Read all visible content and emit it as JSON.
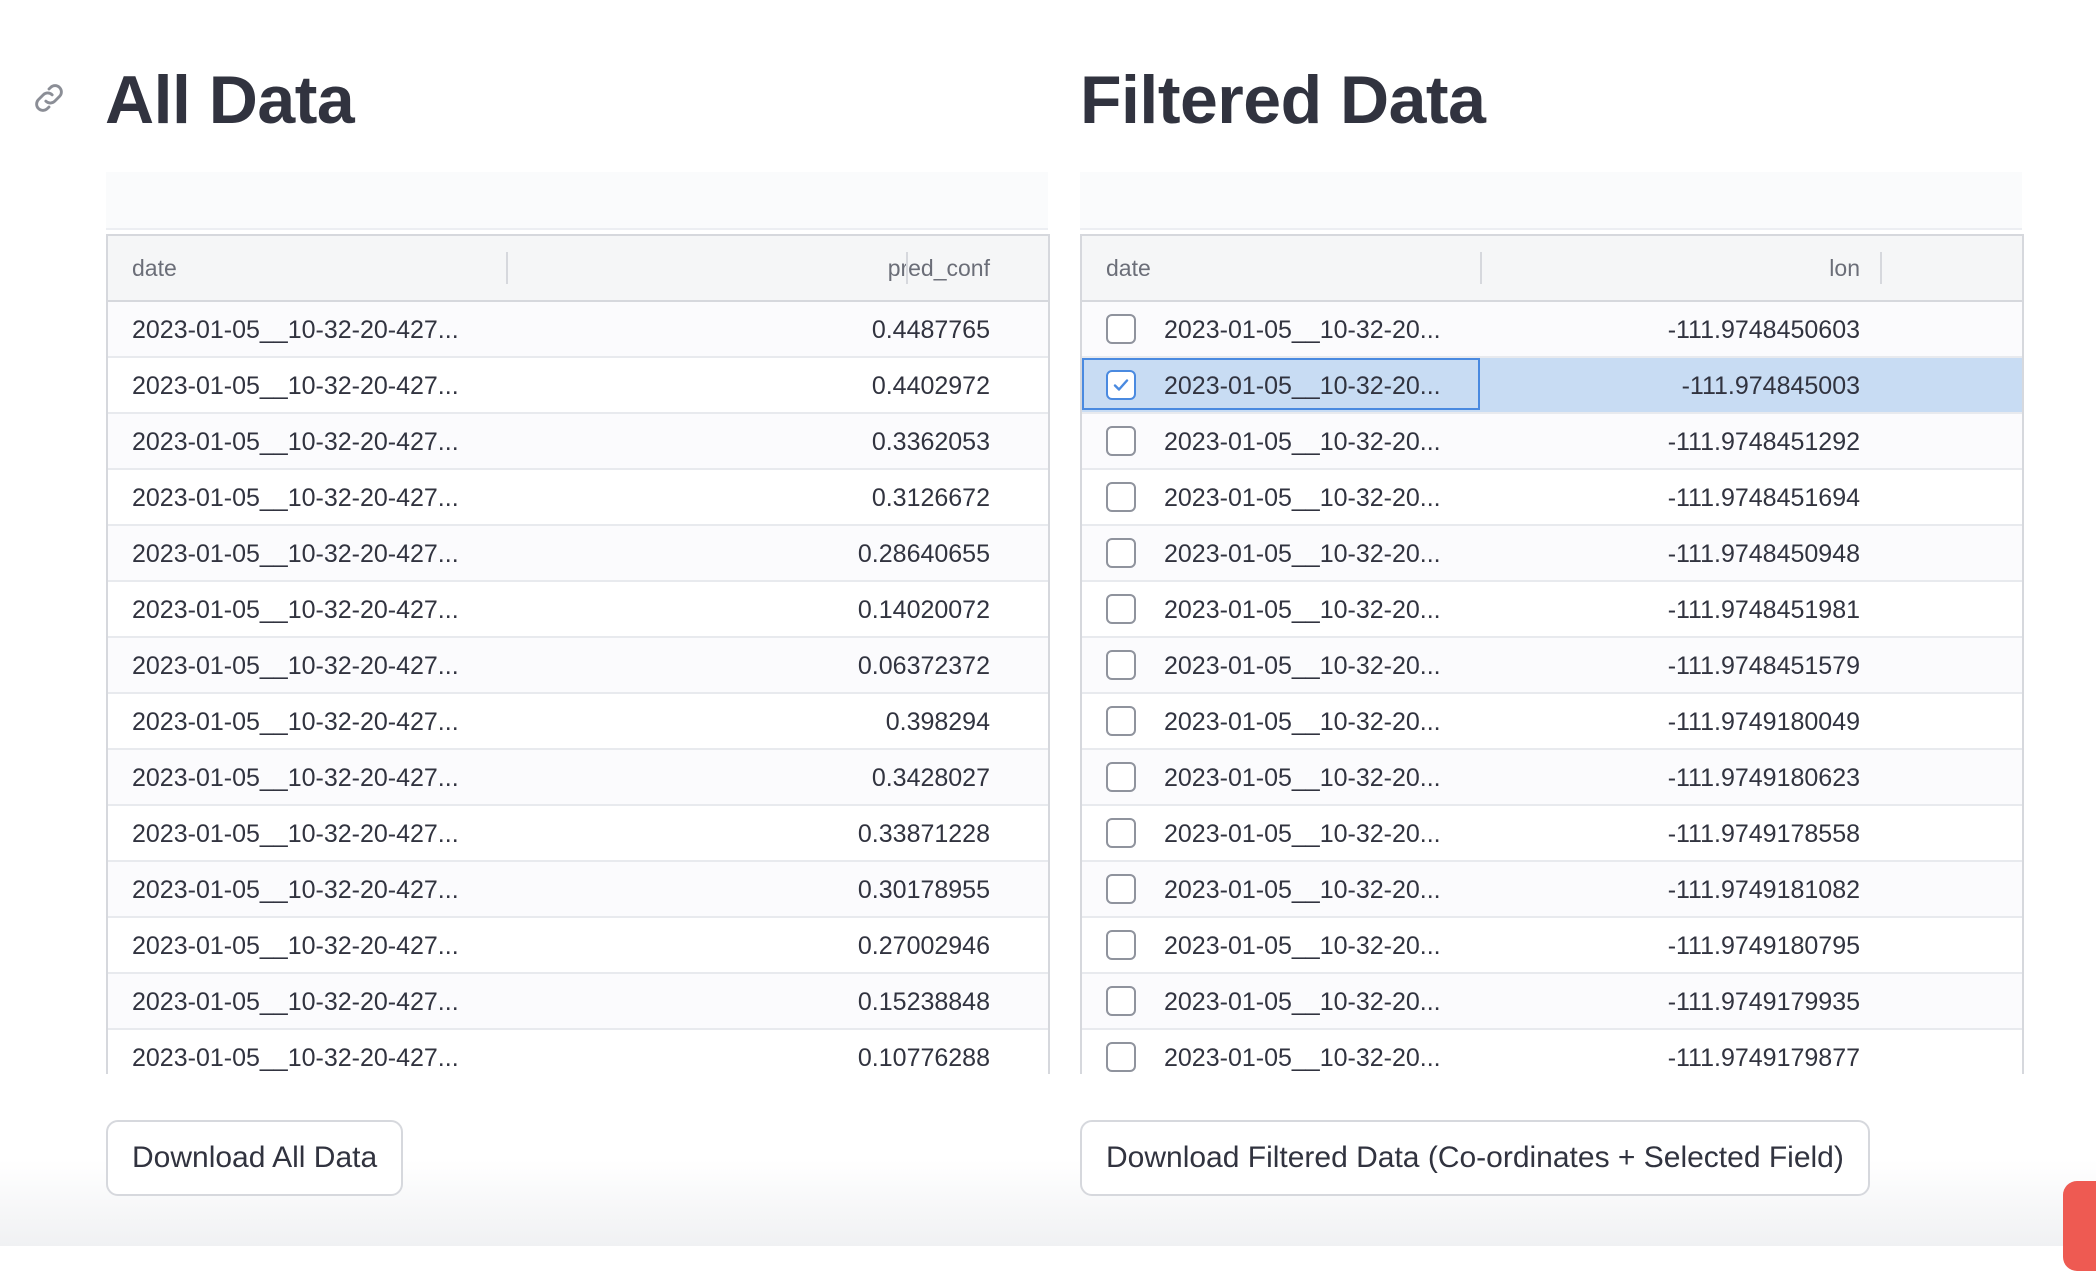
{
  "all_data": {
    "title": "All Data",
    "columns": [
      "date",
      "pred_conf"
    ],
    "rows": [
      {
        "date": "2023-01-05__10-32-20-427...",
        "value": "0.4487765"
      },
      {
        "date": "2023-01-05__10-32-20-427...",
        "value": "0.4402972"
      },
      {
        "date": "2023-01-05__10-32-20-427...",
        "value": "0.3362053"
      },
      {
        "date": "2023-01-05__10-32-20-427...",
        "value": "0.3126672"
      },
      {
        "date": "2023-01-05__10-32-20-427...",
        "value": "0.28640655"
      },
      {
        "date": "2023-01-05__10-32-20-427...",
        "value": "0.14020072"
      },
      {
        "date": "2023-01-05__10-32-20-427...",
        "value": "0.06372372"
      },
      {
        "date": "2023-01-05__10-32-20-427...",
        "value": "0.398294"
      },
      {
        "date": "2023-01-05__10-32-20-427...",
        "value": "0.3428027"
      },
      {
        "date": "2023-01-05__10-32-20-427...",
        "value": "0.33871228"
      },
      {
        "date": "2023-01-05__10-32-20-427...",
        "value": "0.30178955"
      },
      {
        "date": "2023-01-05__10-32-20-427...",
        "value": "0.27002946"
      },
      {
        "date": "2023-01-05__10-32-20-427...",
        "value": "0.15238848"
      },
      {
        "date": "2023-01-05__10-32-20-427...",
        "value": "0.10776288"
      }
    ],
    "download_label": "Download All Data"
  },
  "filtered_data": {
    "title": "Filtered Data",
    "columns": [
      "date",
      "lon"
    ],
    "rows": [
      {
        "date": "2023-01-05__10-32-20...",
        "value": "-111.9748450603",
        "checked": false
      },
      {
        "date": "2023-01-05__10-32-20...",
        "value": "-111.974845003",
        "checked": true
      },
      {
        "date": "2023-01-05__10-32-20...",
        "value": "-111.9748451292",
        "checked": false
      },
      {
        "date": "2023-01-05__10-32-20...",
        "value": "-111.9748451694",
        "checked": false
      },
      {
        "date": "2023-01-05__10-32-20...",
        "value": "-111.9748450948",
        "checked": false
      },
      {
        "date": "2023-01-05__10-32-20...",
        "value": "-111.9748451981",
        "checked": false
      },
      {
        "date": "2023-01-05__10-32-20...",
        "value": "-111.9748451579",
        "checked": false
      },
      {
        "date": "2023-01-05__10-32-20...",
        "value": "-111.9749180049",
        "checked": false
      },
      {
        "date": "2023-01-05__10-32-20...",
        "value": "-111.9749180623",
        "checked": false
      },
      {
        "date": "2023-01-05__10-32-20...",
        "value": "-111.9749178558",
        "checked": false
      },
      {
        "date": "2023-01-05__10-32-20...",
        "value": "-111.9749181082",
        "checked": false
      },
      {
        "date": "2023-01-05__10-32-20...",
        "value": "-111.9749180795",
        "checked": false
      },
      {
        "date": "2023-01-05__10-32-20...",
        "value": "-111.9749179935",
        "checked": false
      },
      {
        "date": "2023-01-05__10-32-20...",
        "value": "-111.9749179877",
        "checked": false
      }
    ],
    "download_label": "Download Filtered Data (Co-ordinates + Selected Field)"
  },
  "icons": {
    "anchor": "link-icon",
    "checkbox_checked": "checkmark-icon"
  },
  "colors": {
    "selection": "#c8dcf3",
    "selection_border": "#4a8ae0",
    "accent": "#ee5a52"
  }
}
